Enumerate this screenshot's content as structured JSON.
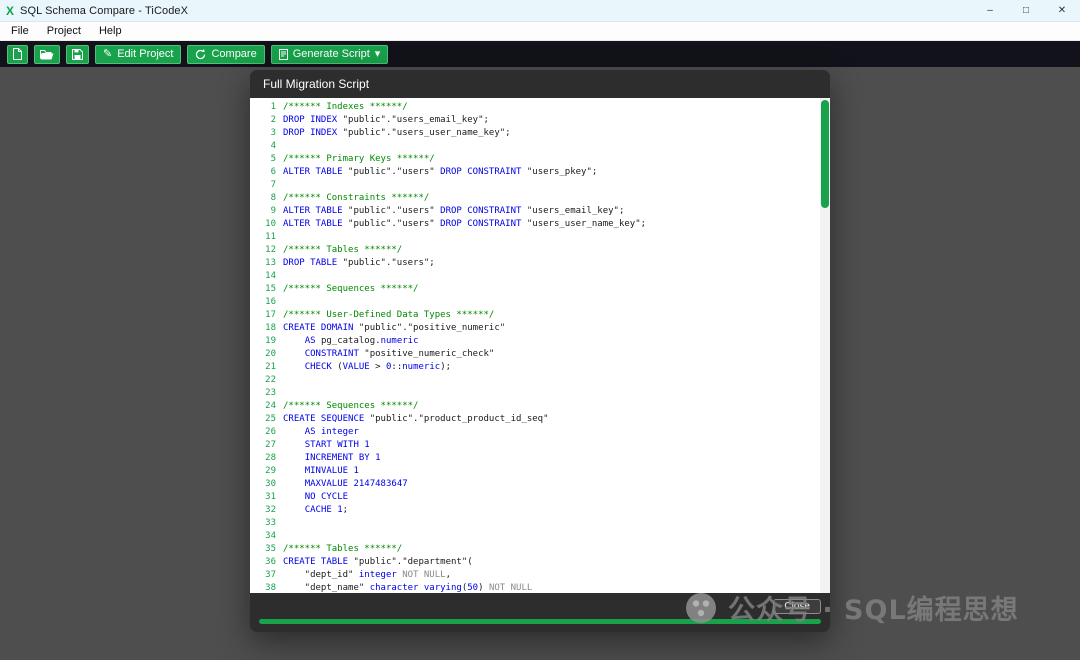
{
  "window": {
    "title": "SQL Schema Compare - TiCodeX",
    "controls": {
      "minimize": "–",
      "maximize": "□",
      "close": "✕"
    },
    "app_icon_glyph": "X"
  },
  "menubar": {
    "items": [
      "File",
      "Project",
      "Help"
    ]
  },
  "toolbar": {
    "buttons": [
      {
        "id": "new",
        "label": ""
      },
      {
        "id": "open",
        "label": ""
      },
      {
        "id": "save",
        "label": ""
      },
      {
        "id": "edit-project",
        "label": "Edit Project",
        "icon_glyph": "✎"
      },
      {
        "id": "compare",
        "label": "Compare"
      },
      {
        "id": "generate-script",
        "label": "Generate Script",
        "caret": "▾"
      }
    ]
  },
  "dialog": {
    "title": "Full Migration Script",
    "close_label": "Close",
    "code": {
      "lines": [
        [
          [
            "c",
            "/****** Indexes ******/"
          ]
        ],
        [
          [
            "k",
            "DROP INDEX"
          ],
          [
            "p",
            " \"public\".\"users_email_key\";"
          ]
        ],
        [
          [
            "k",
            "DROP INDEX"
          ],
          [
            "p",
            " \"public\".\"users_user_name_key\";"
          ]
        ],
        [],
        [
          [
            "c",
            "/****** Primary Keys ******/"
          ]
        ],
        [
          [
            "k",
            "ALTER TABLE"
          ],
          [
            "p",
            " \"public\".\"users\" "
          ],
          [
            "k",
            "DROP CONSTRAINT"
          ],
          [
            "p",
            " \"users_pkey\";"
          ]
        ],
        [],
        [
          [
            "c",
            "/****** Constraints ******/"
          ]
        ],
        [
          [
            "k",
            "ALTER TABLE"
          ],
          [
            "p",
            " \"public\".\"users\" "
          ],
          [
            "k",
            "DROP CONSTRAINT"
          ],
          [
            "p",
            " \"users_email_key\";"
          ]
        ],
        [
          [
            "k",
            "ALTER TABLE"
          ],
          [
            "p",
            " \"public\".\"users\" "
          ],
          [
            "k",
            "DROP CONSTRAINT"
          ],
          [
            "p",
            " \"users_user_name_key\";"
          ]
        ],
        [],
        [
          [
            "c",
            "/****** Tables ******/"
          ]
        ],
        [
          [
            "k",
            "DROP TABLE"
          ],
          [
            "p",
            " \"public\".\"users\";"
          ]
        ],
        [],
        [
          [
            "c",
            "/****** Sequences ******/"
          ]
        ],
        [],
        [
          [
            "c",
            "/****** User-Defined Data Types ******/"
          ]
        ],
        [
          [
            "k",
            "CREATE DOMAIN"
          ],
          [
            "p",
            " \"public\".\"positive_numeric\""
          ]
        ],
        [
          [
            "p",
            "    "
          ],
          [
            "k",
            "AS"
          ],
          [
            "p",
            " pg_catalog."
          ],
          [
            "k",
            "numeric"
          ]
        ],
        [
          [
            "p",
            "    "
          ],
          [
            "k",
            "CONSTRAINT"
          ],
          [
            "p",
            " \"positive_numeric_check\""
          ]
        ],
        [
          [
            "p",
            "    "
          ],
          [
            "k",
            "CHECK"
          ],
          [
            "p",
            " ("
          ],
          [
            "k",
            "VALUE"
          ],
          [
            "p",
            " > "
          ],
          [
            "n",
            "0"
          ],
          [
            "p",
            "::"
          ],
          [
            "k",
            "numeric"
          ],
          [
            "p",
            ");"
          ]
        ],
        [],
        [],
        [
          [
            "c",
            "/****** Sequences ******/"
          ]
        ],
        [
          [
            "k",
            "CREATE SEQUENCE"
          ],
          [
            "p",
            " \"public\".\"product_product_id_seq\""
          ]
        ],
        [
          [
            "p",
            "    "
          ],
          [
            "k",
            "AS integer"
          ]
        ],
        [
          [
            "p",
            "    "
          ],
          [
            "k",
            "START WITH"
          ],
          [
            "p",
            " "
          ],
          [
            "n",
            "1"
          ]
        ],
        [
          [
            "p",
            "    "
          ],
          [
            "k",
            "INCREMENT BY"
          ],
          [
            "p",
            " "
          ],
          [
            "n",
            "1"
          ]
        ],
        [
          [
            "p",
            "    "
          ],
          [
            "k",
            "MINVALUE"
          ],
          [
            "p",
            " "
          ],
          [
            "n",
            "1"
          ]
        ],
        [
          [
            "p",
            "    "
          ],
          [
            "k",
            "MAXVALUE"
          ],
          [
            "p",
            " "
          ],
          [
            "n",
            "2147483647"
          ]
        ],
        [
          [
            "p",
            "    "
          ],
          [
            "k",
            "NO CYCLE"
          ]
        ],
        [
          [
            "p",
            "    "
          ],
          [
            "k",
            "CACHE"
          ],
          [
            "p",
            " "
          ],
          [
            "n",
            "1"
          ],
          [
            "p",
            ";"
          ]
        ],
        [],
        [],
        [
          [
            "c",
            "/****** Tables ******/"
          ]
        ],
        [
          [
            "k",
            "CREATE TABLE"
          ],
          [
            "p",
            " \"public\".\"department\"("
          ]
        ],
        [
          [
            "p",
            "    \"dept_id\" "
          ],
          [
            "k",
            "integer"
          ],
          [
            "p",
            " "
          ],
          [
            "g",
            "NOT NULL"
          ],
          [
            "p",
            ","
          ]
        ],
        [
          [
            "p",
            "    \"dept_name\" "
          ],
          [
            "k",
            "character varying"
          ],
          [
            "p",
            "("
          ],
          [
            "n",
            "50"
          ],
          [
            "p",
            ") "
          ],
          [
            "g",
            "NOT NULL"
          ]
        ]
      ]
    }
  },
  "watermark": {
    "text": "公众号 · SQL编程思想"
  },
  "colors": {
    "accent_green": "#17a24b",
    "toolbar_bg": "#12121a",
    "overlay_bg": "#4e4e4e",
    "dialog_chrome": "#2d2d2d",
    "syntax_comment": "#008a00",
    "syntax_keyword": "#0000e8",
    "syntax_number": "#0000e8",
    "syntax_muted": "#8a8a8a",
    "line_number_color": "#17a24b"
  }
}
